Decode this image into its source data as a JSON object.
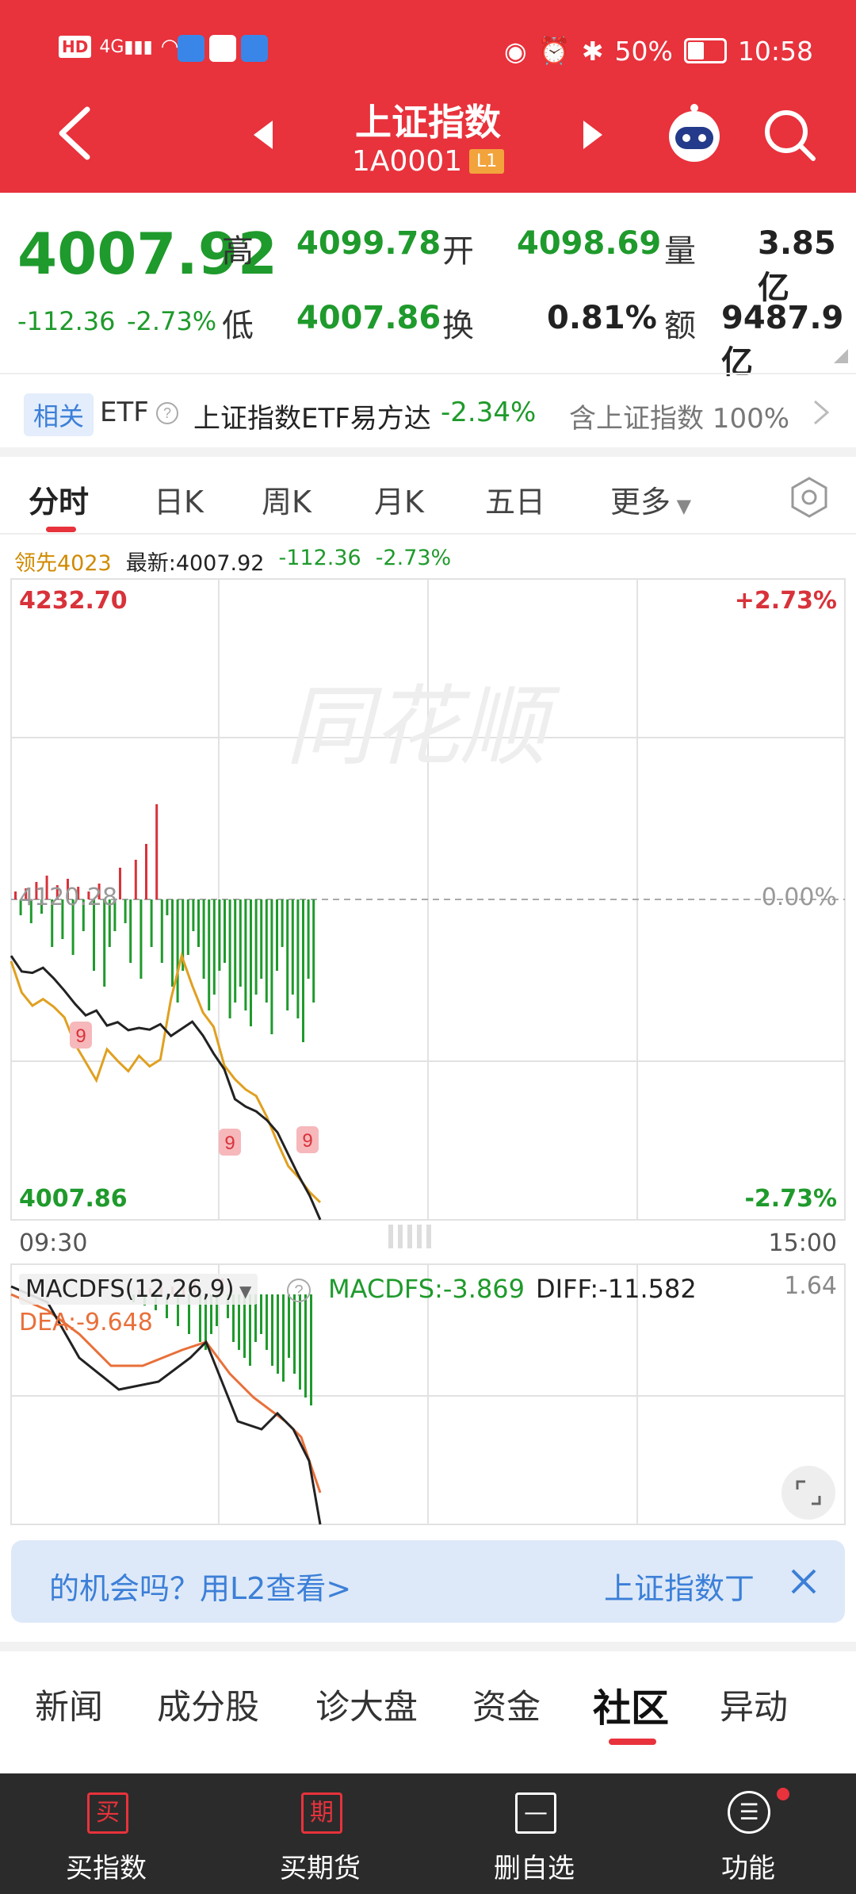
{
  "status_bar": {
    "left_text": "HD 4G",
    "battery": "50%",
    "time": "10:58"
  },
  "header": {
    "title": "上证指数",
    "code": "1A0001",
    "level_badge": "L1"
  },
  "quote": {
    "price": "4007.92",
    "change": "-112.36",
    "change_pct": "-2.73%",
    "high_label": "高",
    "high": "4099.78",
    "open_label": "开",
    "open": "4098.69",
    "volume_label": "量",
    "volume": "3.85亿",
    "low_label": "低",
    "low": "4007.86",
    "turnover_label": "换",
    "turnover": "0.81%",
    "amount_label": "额",
    "amount": "9487.9亿"
  },
  "etf": {
    "tag": "相关",
    "etf_label": "ETF",
    "name": "上证指数ETF易方达",
    "pct": "-2.34%",
    "weight": "含上证指数 100%"
  },
  "chart_tabs": [
    {
      "label": "分时"
    },
    {
      "label": "日K"
    },
    {
      "label": "周K"
    },
    {
      "label": "月K"
    },
    {
      "label": "五日"
    },
    {
      "label": "更多"
    }
  ],
  "chart_info": {
    "leader": "领先4023",
    "latest": "最新:4007.92",
    "change": "-112.36",
    "pct": "-2.73%"
  },
  "chart_data": {
    "type": "line",
    "y_max_label": "4232.70",
    "y_max_pct": "+2.73%",
    "y_mid_label": "4120.28",
    "y_mid_pct": "0.00%",
    "y_min_label": "4007.86",
    "y_min_pct": "-2.73%",
    "x_start": "09:30",
    "x_end": "15:00",
    "ylim": [
      4007.86,
      4232.7
    ],
    "watermark": "同花顺",
    "series": [
      {
        "values": [
          4100.5,
          4095.0,
          4094.5,
          4096.3,
          4092.6,
          4088.3,
          4083.6,
          4079.6,
          4081.3,
          4076.0,
          4077.2,
          4074.4,
          4075.2,
          4074.6,
          4076.5,
          4072.4,
          4074.9,
          4077.4,
          4072.5,
          4066.2,
          4060.7,
          4050.2,
          4047.6,
          4045.9,
          4042.8,
          4038.5,
          4030.8,
          4023.2,
          4016.4,
          4007.9
        ]
      },
      {
        "values": [
          4098.6,
          4087.6,
          4083.0,
          4085.3,
          4082.6,
          4078.9,
          4069.5,
          4063.2,
          4056.8,
          4067.7,
          4063.6,
          4060.0,
          4065.4,
          4061.7,
          4064.1,
          4085.3,
          4100.5,
          4090.0,
          4080.6,
          4075.6,
          4062.0,
          4057.2,
          4053.6,
          4051.3,
          4043.9,
          4034.9,
          4026.7,
          4022.6,
          4017.6,
          4014.0
        ]
      }
    ],
    "markers": [
      "9",
      "9",
      "9"
    ]
  },
  "macd": {
    "title": "MACDFS(12,26,9)",
    "macdfs": "MACDFS:-3.869",
    "diff": "DIFF:-11.582",
    "dea": "DEA:-9.648",
    "top_label": "1.64"
  },
  "promo": {
    "left_text": "的机会吗？用L2查看>",
    "right_text": "上证指数丁"
  },
  "bottom_tabs": [
    {
      "label": "新闻"
    },
    {
      "label": "成分股"
    },
    {
      "label": "诊大盘"
    },
    {
      "label": "资金"
    },
    {
      "label": "社区"
    },
    {
      "label": "异动"
    }
  ],
  "footer": [
    {
      "label": "买指数",
      "icon": "买"
    },
    {
      "label": "买期货",
      "icon": "期"
    },
    {
      "label": "删自选",
      "icon": "—"
    },
    {
      "label": "功能",
      "icon": "☰"
    }
  ],
  "colors": {
    "accent": "#e8323c",
    "up": "#d8323a",
    "down": "#1f9a2c",
    "avg": "#e0a020"
  }
}
